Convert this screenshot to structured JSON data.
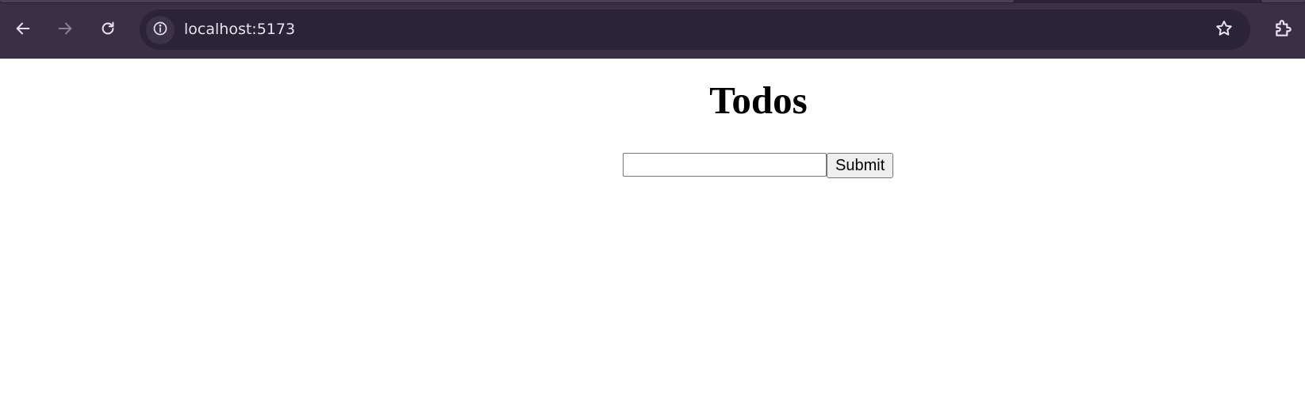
{
  "browser": {
    "address_bar": {
      "url": "localhost:5173"
    },
    "icons": {
      "back": "arrow-left-icon",
      "forward": "arrow-right-icon",
      "reload": "reload-icon",
      "site_info": "info-icon",
      "bookmark": "star-icon",
      "extensions": "puzzle-icon"
    },
    "colors": {
      "toolbar": "#3a2f45",
      "omnibox": "#2b2337",
      "icon": "#e8e4ee",
      "icon_disabled": "#8a8194"
    }
  },
  "page": {
    "title": "Todos",
    "form": {
      "input_value": "",
      "submit_label": "Submit"
    }
  }
}
